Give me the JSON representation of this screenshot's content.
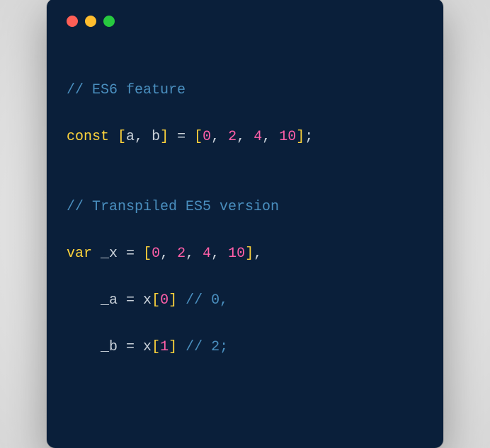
{
  "code": {
    "l1_comment": "// ES6 feature",
    "l2_const": "const",
    "l2_open1": " [",
    "l2_a": "a",
    "l2_c1": ", ",
    "l2_b": "b",
    "l2_close1": "]",
    "l2_eq": " = ",
    "l2_open2": "[",
    "l2_n0": "0",
    "l2_c2": ", ",
    "l2_n2": "2",
    "l2_c3": ", ",
    "l2_n4": "4",
    "l2_c4": ", ",
    "l2_n10": "10",
    "l2_close2": "]",
    "l2_semi": ";",
    "l3_blank": "",
    "l4_comment": "// Transpiled ES5 version",
    "l5_var": "var",
    "l5_sp": " ",
    "l5_x": "_x",
    "l5_eq": " = ",
    "l5_open": "[",
    "l5_n0": "0",
    "l5_c1": ", ",
    "l5_n2": "2",
    "l5_c2": ", ",
    "l5_n4": "4",
    "l5_c3": ", ",
    "l5_n10": "10",
    "l5_close": "]",
    "l5_comma": ",",
    "l6_indent": "    ",
    "l6_a": "_a",
    "l6_eq": " = ",
    "l6_xi": "x",
    "l6_open": "[",
    "l6_n0": "0",
    "l6_close": "]",
    "l6_sp": " ",
    "l6_comment": "// 0,",
    "l7_indent": "    ",
    "l7_b": "_b",
    "l7_eq": " = ",
    "l7_xi": "x",
    "l7_open": "[",
    "l7_n1": "1",
    "l7_close": "]",
    "l7_sp": " ",
    "l7_comment": "// 2;"
  }
}
